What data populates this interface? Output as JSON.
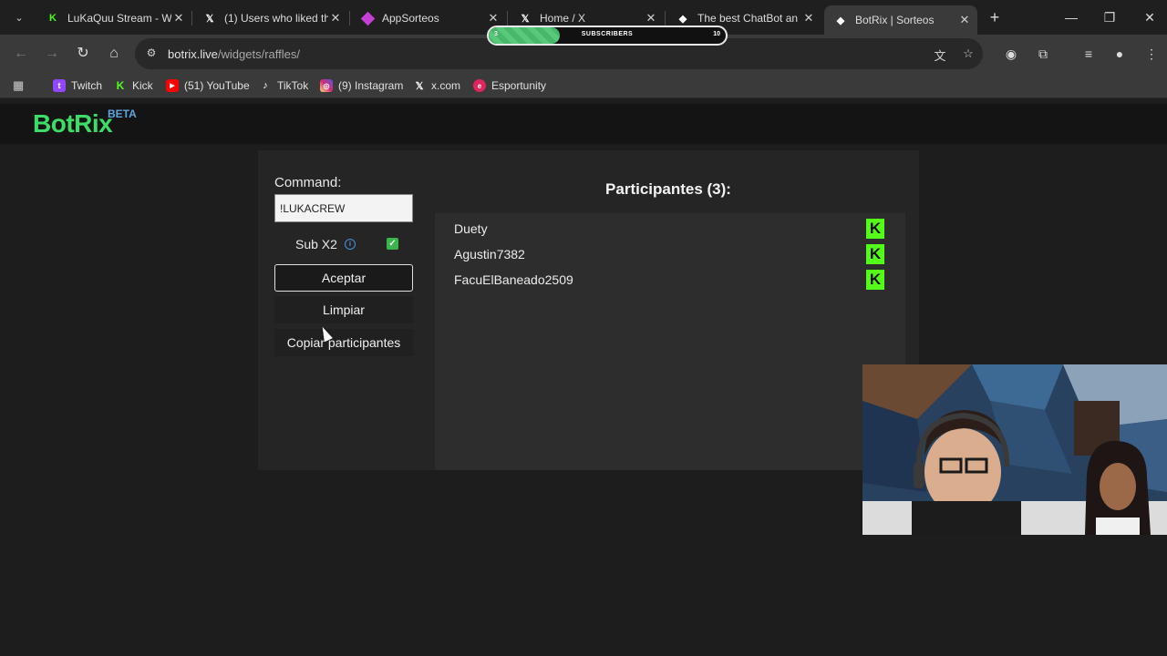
{
  "browser": {
    "tabs": [
      {
        "title": "LuKaQuu Stream - W",
        "icon": "kick-icon",
        "color": "#53fc18"
      },
      {
        "title": "(1) Users who liked th",
        "icon": "x-icon",
        "color": "#ffffff"
      },
      {
        "title": "AppSorteos",
        "icon": "appsorteos-icon",
        "color": "#c43fd6"
      },
      {
        "title": "Home / X",
        "icon": "x-icon",
        "color": "#ffffff"
      },
      {
        "title": "The best ChatBot an",
        "icon": "botrix-icon",
        "color": "#ffffff"
      },
      {
        "title": "BotRix | Sorteos",
        "icon": "botrix-icon",
        "color": "#ffffff"
      }
    ],
    "url_host": "botrix.live",
    "url_path": "/widgets/raffles/",
    "bookmarks": [
      {
        "label": "Twitch",
        "icon": "twitch-icon",
        "color": "#9146ff"
      },
      {
        "label": "Kick",
        "icon": "kick-icon",
        "color": "#53fc18"
      },
      {
        "label": "(51) YouTube",
        "icon": "youtube-icon",
        "color": "#ff0000"
      },
      {
        "label": "TikTok",
        "icon": "tiktok-icon",
        "color": "#111111"
      },
      {
        "label": "(9) Instagram",
        "icon": "instagram-icon",
        "color": "#d6249f"
      },
      {
        "label": "x.com",
        "icon": "x-icon",
        "color": "#111111"
      },
      {
        "label": "Esportunity",
        "icon": "esportunity-icon",
        "color": "#e0245e"
      }
    ]
  },
  "overlay": {
    "subscribers_label": "SUBSCRIBERS",
    "current": "3",
    "goal": "10",
    "progress_fraction": 0.3
  },
  "site": {
    "logo": "BotRix",
    "beta": "BETA"
  },
  "raffle": {
    "command_label": "Command:",
    "command_value": "!LUKACREW",
    "sub_label": "Sub X2",
    "sub_checked": true,
    "accept_label": "Aceptar",
    "clear_label": "Limpiar",
    "copy_label": "Copiar participantes",
    "participants_title": "Participantes (3):",
    "participants": [
      {
        "name": "Duety",
        "platform": "kick-icon"
      },
      {
        "name": "Agustin7382",
        "platform": "kick-icon"
      },
      {
        "name": "FacuElBaneado2509",
        "platform": "kick-icon"
      }
    ]
  },
  "colors": {
    "accent": "#3ddc68",
    "kick": "#53fc18"
  }
}
